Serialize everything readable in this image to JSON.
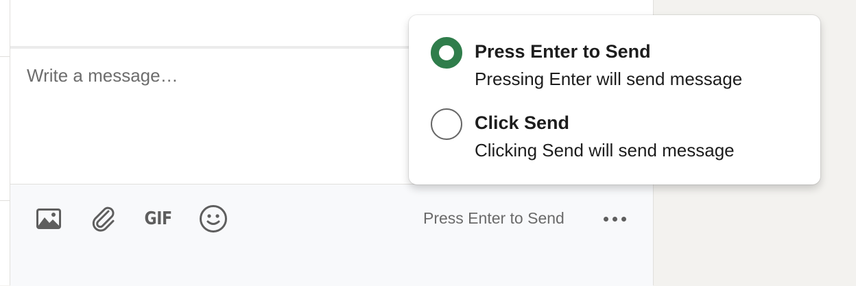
{
  "compose": {
    "placeholder": "Write a message…"
  },
  "toolbar": {
    "image_icon": "image-icon",
    "attach_icon": "paperclip-icon",
    "gif_label": "GIF",
    "emoji_icon": "smiley-icon",
    "send_mode_label": "Press Enter to Send",
    "more_icon": "ellipsis-icon"
  },
  "send_options": {
    "selected_index": 0,
    "options": [
      {
        "title": "Press Enter to Send",
        "description": "Pressing Enter will send message",
        "checked": true
      },
      {
        "title": "Click Send",
        "description": "Clicking Send will send message",
        "checked": false
      }
    ]
  },
  "colors": {
    "accent": "#2f7d4b",
    "page_background": "#f3f2ef",
    "toolbar_background": "#f8f9fb"
  }
}
